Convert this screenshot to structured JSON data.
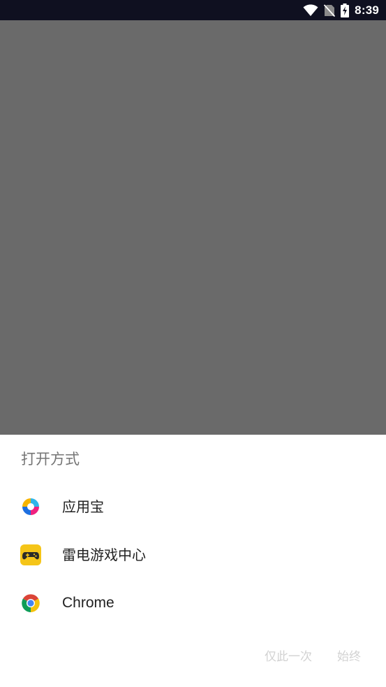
{
  "status_bar": {
    "time": "8:39",
    "icons": [
      "wifi-icon",
      "no-sim-icon",
      "battery-charging-icon"
    ]
  },
  "chooser": {
    "title": "打开方式",
    "apps": [
      {
        "label": "应用宝",
        "icon": "yingyongbao-icon"
      },
      {
        "label": "雷电游戏中心",
        "icon": "gamepad-icon"
      },
      {
        "label": "Chrome",
        "icon": "chrome-icon"
      }
    ],
    "just_once_label": "仅此一次",
    "always_label": "始终"
  },
  "colors": {
    "status_bar_bg": "#0f1020",
    "scrim": "#6a6a6a",
    "sheet_bg": "#ffffff",
    "title_text": "#757575",
    "disabled_action": "#d2d2d2",
    "game_center_yellow": "#f5c518"
  }
}
